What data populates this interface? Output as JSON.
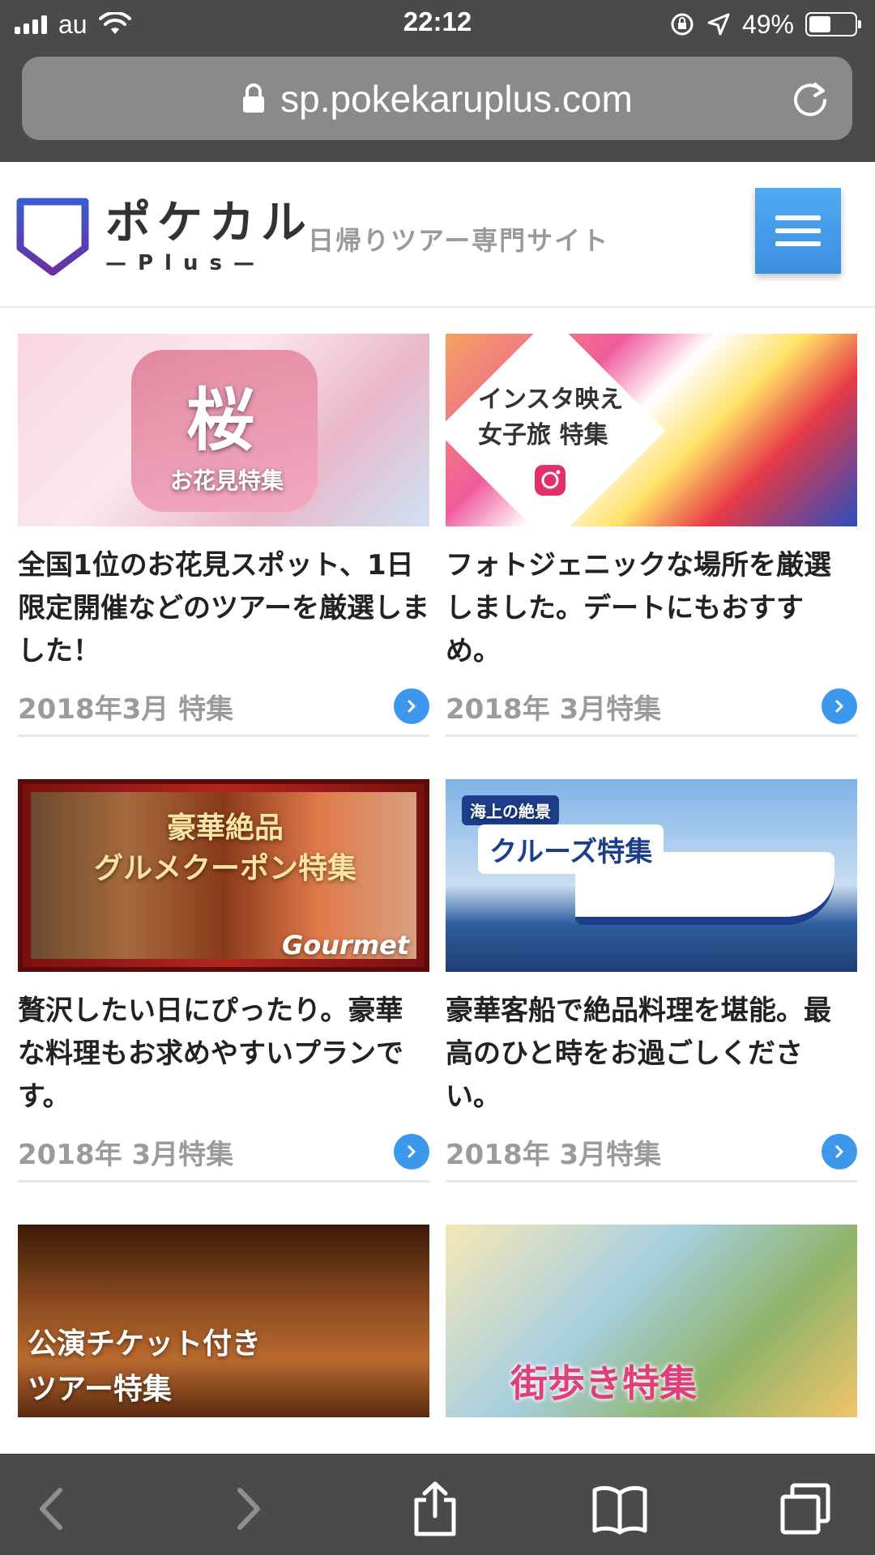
{
  "status_bar": {
    "carrier": "au",
    "time": "22:12",
    "battery_percent": "49%",
    "battery_level": 0.49
  },
  "browser": {
    "url": "sp.pokekaruplus.com"
  },
  "site": {
    "brand_main": "ポケカル",
    "brand_sub": "—Plus—",
    "tagline": "日帰りツアー専門サイト",
    "brand_color": "#4b3a96",
    "accent_color": "#3d97ea"
  },
  "cards": [
    {
      "thumb_text": "桜",
      "thumb_sub": "お花見特集",
      "description": "全国1位のお花見スポット、1日限定開催などのツアーを厳選しました！",
      "date": "2018年3月 特集"
    },
    {
      "thumb_text": "インスタ映え\n女子旅 特集",
      "description": "フォトジェニックな場所を厳選しました。デートにもおすすめ。",
      "date": "2018年 3月特集"
    },
    {
      "thumb_text": "豪華絶品\nグルメクーポン特集",
      "thumb_sub": "Gourmet",
      "description": "贅沢したい日にぴったり。豪華な料理もお求めやすいプランです。",
      "date": "2018年 3月特集"
    },
    {
      "thumb_text": "クルーズ特集",
      "thumb_sub": "海上の絶景",
      "description": "豪華客船で絶品料理を堪能。最高のひと時をお過ごしください。",
      "date": "2018年 3月特集"
    },
    {
      "thumb_text": "公演チケット付き\nツアー特集",
      "description": "",
      "date": ""
    },
    {
      "thumb_text": "街歩き特集",
      "description": "",
      "date": ""
    }
  ]
}
